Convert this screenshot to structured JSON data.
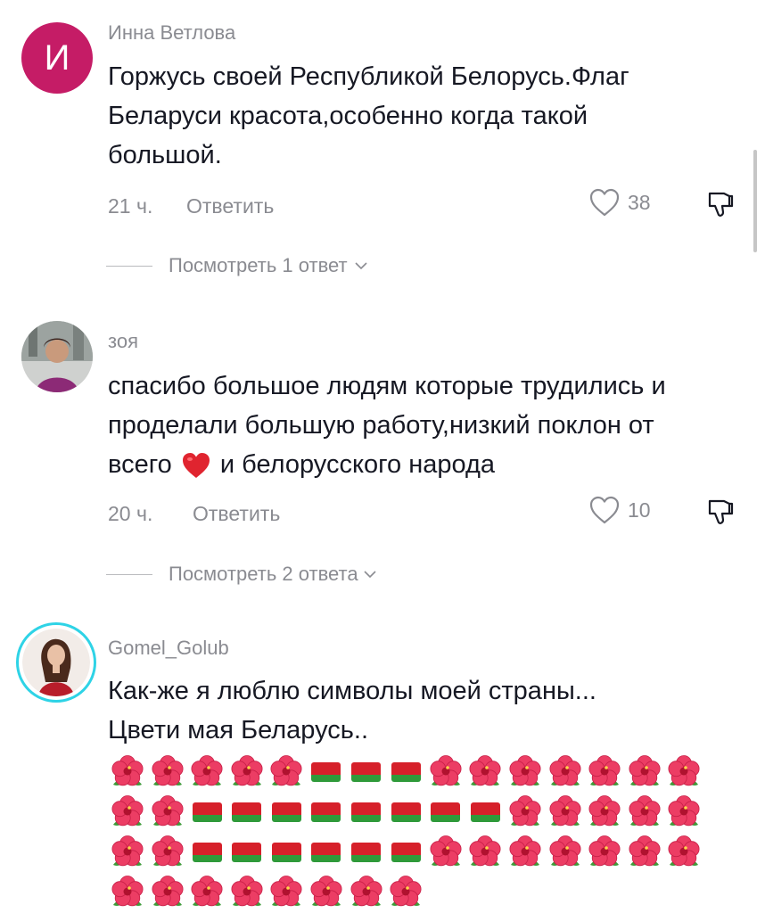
{
  "comments": [
    {
      "avatar_letter": "И",
      "author": "Инна Ветлова",
      "text": "Горжусь своей Республикой Белорусь.Флаг Беларуси красота,особенно когда такой большой.",
      "lines": [
        "Горжусь своей Республикой Белорусь.Флаг",
        "Беларуси красота,особенно когда такой",
        "большой."
      ],
      "time": "21 ч.",
      "reply_label": "Ответить",
      "likes": "38",
      "view_replies": "Посмотреть 1 ответ"
    },
    {
      "author": "зоя",
      "lines": [
        "спасибо большое людям которые трудились и",
        "проделали большую работу,низкий поклон от"
      ],
      "line3_before": "всего",
      "line3_after": "и белорусского народа",
      "time": "20 ч.",
      "reply_label": "Ответить",
      "likes": "10",
      "view_replies": "Посмотреть 2 ответа"
    },
    {
      "author": "Gomel_Golub",
      "lines": [
        "Как-же я люблю символы моей страны...",
        "Цвети мая Беларусь.."
      ],
      "emoji_rows": [
        [
          "flower",
          "flower",
          "flower",
          "flower",
          "flower",
          "flag",
          "flag",
          "flag",
          "flower",
          "flower",
          "flower",
          "flower",
          "flower",
          "flower",
          "flower"
        ],
        [
          "flower",
          "flower",
          "flag",
          "flag",
          "flag",
          "flag",
          "flag",
          "flag",
          "flag",
          "flag",
          "flower",
          "flower",
          "flower",
          "flower",
          "flower"
        ],
        [
          "flower",
          "flower",
          "flag",
          "flag",
          "flag",
          "flag",
          "flag",
          "flag",
          "flower",
          "flower",
          "flower",
          "flower",
          "flower",
          "flower",
          "flower"
        ],
        [
          "flower",
          "flower",
          "flower",
          "flower",
          "flower",
          "flower",
          "flower",
          "flower"
        ]
      ]
    }
  ],
  "colors": {
    "accent_avatar": "#c51c66",
    "secondary_text": "#8a8b91",
    "story_ring": "#2ed3e6",
    "heart_red": "#e0242f"
  },
  "icons": [
    "heart-outline-icon",
    "dislike-icon",
    "chevron-down-icon",
    "scrollbar"
  ]
}
